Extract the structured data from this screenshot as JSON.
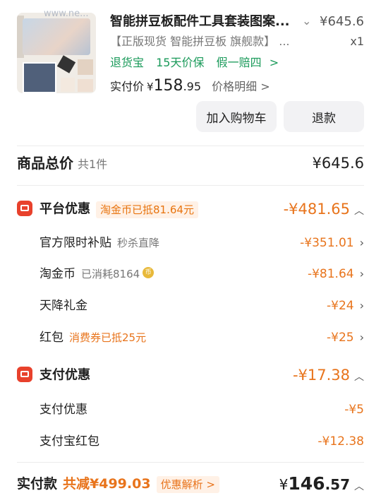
{
  "watermark": "www.ne...",
  "product": {
    "title": "智能拼豆板配件工具套装图案...",
    "price": "¥645.6",
    "sku": "【正版现货 智能拼豆板 旗舰款】 ...",
    "qty": "x1",
    "services": [
      "退货宝",
      "15天价保",
      "假一赔四"
    ],
    "services_arrow": ">",
    "paid_label": "实付价",
    "paid_yen": "¥",
    "paid_int": "158",
    "paid_dec": ".95",
    "price_detail": "价格明细 >"
  },
  "buttons": {
    "cart": "加入购物车",
    "refund": "退款"
  },
  "summary": {
    "label": "商品总价",
    "count": "共1件",
    "total": "¥645.6"
  },
  "platform": {
    "title": "平台优惠",
    "tag": "淘金币已抵81.64元",
    "amount": "-¥481.65",
    "items": [
      {
        "label": "官方限时补贴",
        "note": "秒杀直降",
        "amount": "-¥351.01"
      },
      {
        "label": "淘金币",
        "note": "已消耗8164",
        "amount": "-¥81.64"
      },
      {
        "label": "天降礼金",
        "note": "",
        "amount": "-¥24"
      },
      {
        "label": "红包",
        "note_orange": "消费券已抵25元",
        "amount": "-¥25"
      }
    ]
  },
  "payment": {
    "title": "支付优惠",
    "amount": "-¥17.38",
    "items": [
      {
        "label": "支付优惠",
        "amount": "-¥5"
      },
      {
        "label": "支付宝红包",
        "amount": "-¥12.38"
      }
    ]
  },
  "final": {
    "label": "实付款",
    "reduce": "共减¥499.03",
    "analysis": "优惠解析 >",
    "yen": "¥",
    "int": "146",
    "dec": ".57"
  },
  "colors": {
    "accent": "#e8741c",
    "green": "#1a9a5a",
    "red_icon": "#e8412c"
  }
}
